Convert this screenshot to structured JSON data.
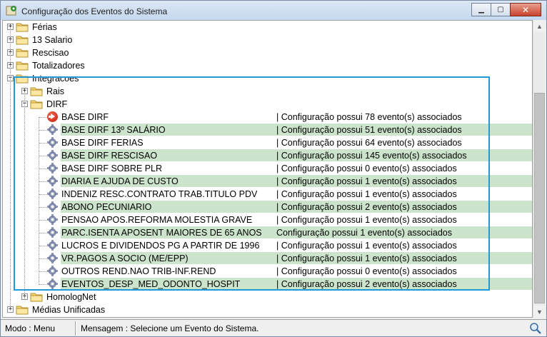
{
  "window": {
    "title": "Configuração dos Eventos do Sistema"
  },
  "tree": {
    "top_nodes": [
      {
        "label": "Férias",
        "toggle": "+"
      },
      {
        "label": "13 Salario",
        "toggle": "+"
      },
      {
        "label": "Rescisao",
        "toggle": "+"
      },
      {
        "label": "Totalizadores",
        "toggle": "+"
      },
      {
        "label": "Integracoes",
        "toggle": "−"
      }
    ],
    "integracoes_children": [
      {
        "label": "Rais",
        "toggle": "+"
      },
      {
        "label": "DIRF",
        "toggle": "−"
      }
    ],
    "dirf_items": [
      {
        "label": "BASE DIRF",
        "desc": "| Configuração possui 78 evento(s) associados",
        "icon": "red-arrow"
      },
      {
        "label": "BASE DIRF 13º SALÁRIO",
        "desc": "| Configuração possui 51 evento(s) associados",
        "icon": "gear"
      },
      {
        "label": "BASE DIRF FERIAS",
        "desc": "| Configuração possui 64 evento(s) associados",
        "icon": "gear"
      },
      {
        "label": "BASE DIRF RESCISAO",
        "desc": "| Configuração possui 145 evento(s) associados",
        "icon": "gear"
      },
      {
        "label": "BASE DIRF SOBRE PLR",
        "desc": "| Configuração possui 0 evento(s) associados",
        "icon": "gear"
      },
      {
        "label": "DIARIA E AJUDA DE CUSTO",
        "desc": "| Configuração possui 1 evento(s) associados",
        "icon": "gear"
      },
      {
        "label": "INDENIZ RESC.CONTRATO TRAB.TITULO PDV",
        "desc": "| Configuração possui 1 evento(s) associados",
        "icon": "gear"
      },
      {
        "label": "ABONO PECUNIARIO",
        "desc": "| Configuração possui 2 evento(s) associados",
        "icon": "gear"
      },
      {
        "label": "PENSAO APOS.REFORMA MOLESTIA GRAVE",
        "desc": "| Configuração possui 1 evento(s) associados",
        "icon": "gear"
      },
      {
        "label": "PARC.ISENTA APOSENT MAIORES DE 65 ANOS",
        "desc": "Configuração possui 1 evento(s) associados",
        "icon": "gear"
      },
      {
        "label": "LUCROS E DIVIDENDOS PG A PARTIR DE 1996",
        "desc": "| Configuração possui 1 evento(s) associados",
        "icon": "gear"
      },
      {
        "label": "VR.PAGOS A SOCIO (ME/EPP)",
        "desc": "| Configuração possui 1 evento(s) associados",
        "icon": "gear"
      },
      {
        "label": "OUTROS REND.NAO TRIB-INF.REND",
        "desc": "| Configuração possui 0 evento(s) associados",
        "icon": "gear"
      },
      {
        "label": "EVENTOS_DESP_MED_ODONTO_HOSPIT",
        "desc": "| Configuração possui 2 evento(s) associados",
        "icon": "gear"
      }
    ],
    "after_dirf": [
      {
        "label": "HomologNet",
        "toggle": "+"
      }
    ],
    "bottom_nodes": [
      {
        "label": "Médias Unificadas",
        "toggle": "+"
      }
    ]
  },
  "status": {
    "mode": "Modo : Menu",
    "message": "Mensagem : Selecione um Evento do Sistema."
  },
  "colors": {
    "highlight": "#cce4cc",
    "selection_border": "#1e9ad6",
    "folder": "#f5d67a"
  }
}
